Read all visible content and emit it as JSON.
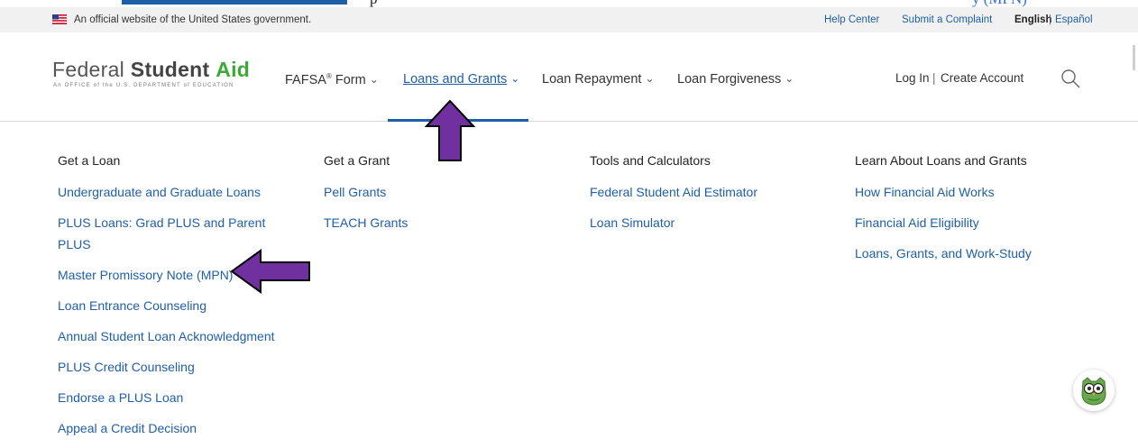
{
  "background_page": {
    "strip_text_dark": "p",
    "strip_text_blue": "y (MPN)"
  },
  "gov_banner": {
    "text": "An official website of the United States government.",
    "links": [
      "Help Center",
      "Submit a Complaint"
    ],
    "lang_current": "English",
    "lang_separator": "|",
    "lang_other": "Español"
  },
  "header": {
    "logo": {
      "word1": "Federal",
      "word2": "Student",
      "word3": "Aid",
      "tagline": "An OFFICE of the U.S. DEPARTMENT of EDUCATION"
    },
    "nav": [
      {
        "label": "FAFSA",
        "sup": "®",
        "suffix": " Form"
      },
      {
        "label": "Loans and Grants"
      },
      {
        "label": "Loan Repayment"
      },
      {
        "label": "Loan Forgiveness"
      }
    ],
    "account": {
      "login": "Log In",
      "separator": "|",
      "create": "Create Account"
    }
  },
  "menu": {
    "columns": [
      {
        "heading": "Get a Loan",
        "links": [
          "Undergraduate and Graduate Loans",
          "PLUS Loans: Grad PLUS and Parent PLUS",
          "Master Promissory Note (MPN)",
          "Loan Entrance Counseling",
          "Annual Student Loan Acknowledgment",
          "PLUS Credit Counseling",
          "Endorse a PLUS Loan",
          "Appeal a Credit Decision"
        ]
      },
      {
        "heading": "Get a Grant",
        "links": [
          "Pell Grants",
          "TEACH Grants"
        ]
      },
      {
        "heading": "Tools and Calculators",
        "links": [
          "Federal Student Aid Estimator",
          "Loan Simulator"
        ]
      },
      {
        "heading": "Learn About Loans and Grants",
        "links": [
          "How Financial Aid Works",
          "Financial Aid Eligibility",
          "Loans, Grants, and Work-Study"
        ]
      }
    ]
  },
  "colors": {
    "link_blue": "#1f5fa8",
    "aid_green": "#3aa935",
    "annotation_purple": "#7030a0",
    "banner_gray": "#f1f1f1"
  }
}
